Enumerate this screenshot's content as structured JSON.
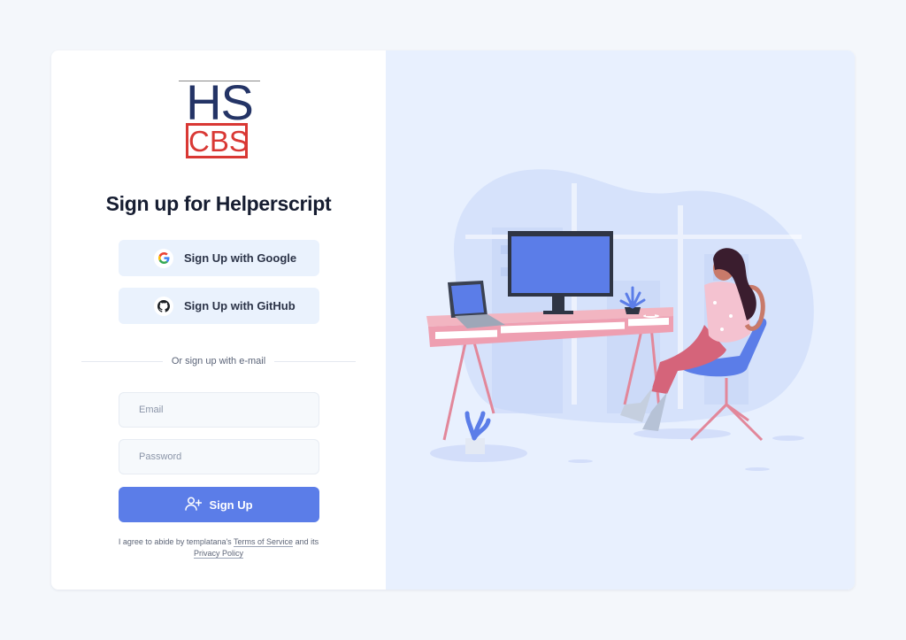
{
  "logo": {
    "top_text": "HS",
    "bottom_text": "CBS"
  },
  "title": "Sign up for Helperscript",
  "buttons": {
    "google": {
      "label": "Sign Up with Google",
      "icon": "google-icon"
    },
    "github": {
      "label": "Sign Up with GitHub",
      "icon": "github-icon"
    },
    "signup": {
      "label": "Sign Up",
      "icon": "user-plus-icon"
    }
  },
  "divider_text": "Or sign up with e-mail",
  "form": {
    "email": {
      "placeholder": "Email",
      "value": ""
    },
    "password": {
      "placeholder": "Password",
      "value": ""
    }
  },
  "terms": {
    "prefix": "I agree to abide by templatana's",
    "tos": "Terms of Service",
    "middle": "and its",
    "privacy": "Privacy Policy"
  },
  "illustration": "woman-at-desk-illustration",
  "colors": {
    "primary": "#5b7de8",
    "title": "#161d31",
    "panel": "#e8f0fe",
    "logo_navy": "#243466",
    "logo_red": "#d93834"
  }
}
